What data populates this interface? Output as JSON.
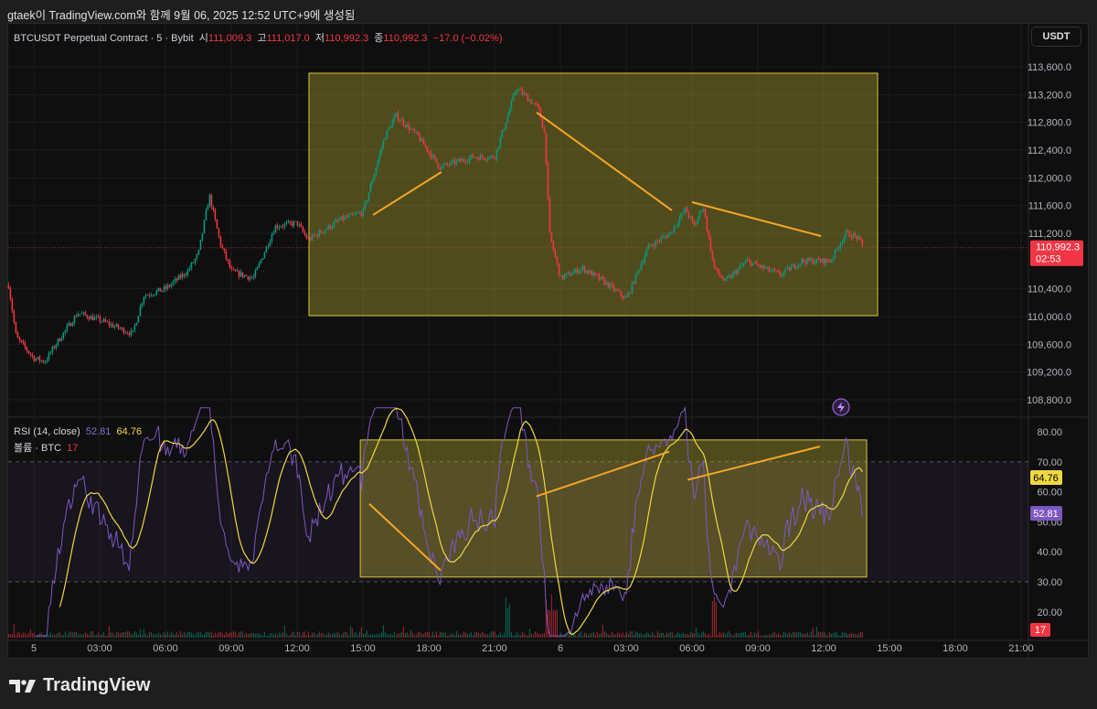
{
  "caption": "gtaek이 TradingView.com와 함께 9월 06, 2025 12:52 UTC+9에 생성됨",
  "legend": {
    "symbol": "BTCUSDT Perpetual Contract · 5 · Bybit",
    "open_label": "시",
    "open": "111,009.3",
    "high_label": "고",
    "high": "111,017.0",
    "low_label": "저",
    "low": "110,992.3",
    "close_label": "종",
    "close": "110,992.3",
    "change": "−17.0 (−0.02%)"
  },
  "rsi_legend": {
    "label": "RSI (14, close)",
    "rsi": "52.81",
    "ma": "64.76"
  },
  "volume_legend": {
    "label": "볼륨 · BTC",
    "value": "17"
  },
  "currency_button": "USDT",
  "price_tag": {
    "price": "110,992.3",
    "countdown": "02:53"
  },
  "rsi_tags": {
    "ma": "64.76",
    "rsi": "52.81",
    "volume": "17"
  },
  "brand": "TradingView",
  "colors": {
    "up": "#089981",
    "down": "#f23645",
    "rsi": "#7e57c2",
    "rsi_ma": "#f0d840",
    "drawing_box": "#d4c53a",
    "drawing_line": "#f5a623"
  },
  "chart_data": {
    "type": "candlestick",
    "interval_minutes": 5,
    "x_unit": "hours since 5 Sep 00:00",
    "price_axis": {
      "ticks": [
        "113,600.0",
        "113,200.0",
        "112,800.0",
        "112,400.0",
        "112,000.0",
        "111,600.0",
        "111,200.0",
        "110,400.0",
        "110,000.0",
        "109,600.0",
        "109,200.0",
        "108,800.0"
      ],
      "tick_values": [
        113600,
        113200,
        112800,
        112400,
        112000,
        111600,
        111200,
        110400,
        110000,
        109600,
        109200,
        108800
      ]
    },
    "rsi_axis": {
      "ticks": [
        "80.00",
        "70.00",
        "60.00",
        "50.00",
        "40.00",
        "30.00",
        "20.00"
      ],
      "tick_values": [
        80,
        70,
        60,
        50,
        40,
        30,
        20
      ],
      "bands": [
        30,
        70
      ]
    },
    "time_axis": {
      "labels": [
        "5",
        "03:00",
        "06:00",
        "09:00",
        "12:00",
        "15:00",
        "18:00",
        "21:00",
        "6",
        "03:00",
        "06:00",
        "09:00",
        "12:00",
        "15:00",
        "18:00",
        "21:00"
      ],
      "hours": [
        0,
        3,
        6,
        9,
        12,
        15,
        18,
        21,
        24,
        27,
        30,
        33,
        36,
        39,
        42,
        45
      ]
    },
    "price_path": [
      [
        -1.15,
        110450
      ],
      [
        -0.8,
        109700
      ],
      [
        0,
        109400
      ],
      [
        0.5,
        109350
      ],
      [
        1,
        109600
      ],
      [
        2,
        110050
      ],
      [
        3,
        109950
      ],
      [
        4.5,
        109750
      ],
      [
        5,
        110300
      ],
      [
        6,
        110400
      ],
      [
        7,
        110650
      ],
      [
        7.5,
        110900
      ],
      [
        8,
        111750
      ],
      [
        8.5,
        111050
      ],
      [
        9,
        110650
      ],
      [
        10,
        110550
      ],
      [
        11,
        111300
      ],
      [
        12,
        111350
      ],
      [
        12.5,
        111100
      ],
      [
        14,
        111400
      ],
      [
        15,
        111500
      ],
      [
        16,
        112600
      ],
      [
        16.5,
        112900
      ],
      [
        17.5,
        112600
      ],
      [
        18.5,
        112150
      ],
      [
        20,
        112300
      ],
      [
        21,
        112300
      ],
      [
        21.5,
        112800
      ],
      [
        22,
        113300
      ],
      [
        23,
        113000
      ],
      [
        23.3,
        112600
      ],
      [
        23.5,
        111200
      ],
      [
        24,
        110550
      ],
      [
        25,
        110700
      ],
      [
        26,
        110500
      ],
      [
        27,
        110250
      ],
      [
        28,
        111000
      ],
      [
        29,
        111200
      ],
      [
        29.7,
        111550
      ],
      [
        30.1,
        111300
      ],
      [
        30.5,
        111600
      ],
      [
        31,
        110700
      ],
      [
        31.5,
        110500
      ],
      [
        32.5,
        110800
      ],
      [
        34,
        110600
      ],
      [
        35,
        110800
      ],
      [
        36.3,
        110800
      ],
      [
        37,
        111200
      ],
      [
        37.5,
        111150
      ],
      [
        37.83,
        110992.3
      ]
    ],
    "last_price": 110992.3,
    "rsi_last": 52.81,
    "rsi_ma_last": 64.76,
    "volume_last": 17,
    "drawings": {
      "price_box": {
        "t": [
          12.54,
          38.46
        ],
        "price": [
          110013,
          113508
        ]
      },
      "price_lines": [
        {
          "t": [
            15.46,
            18.58
          ],
          "price": [
            111464,
            112083
          ]
        },
        {
          "t": [
            22.92,
            29.08
          ],
          "price": [
            112941,
            111530
          ]
        },
        {
          "t": [
            30.0,
            35.88
          ],
          "price": [
            111648,
            111160
          ]
        }
      ],
      "rsi_box": {
        "t": [
          14.88,
          37.96
        ],
        "rsi": [
          31.6,
          77.3
        ]
      },
      "rsi_lines": [
        {
          "t": [
            15.29,
            18.54
          ],
          "rsi": [
            56,
            33.8
          ]
        },
        {
          "t": [
            22.9,
            28.96
          ],
          "rsi": [
            58.5,
            73.4
          ]
        },
        {
          "t": [
            29.8,
            35.83
          ],
          "rsi": [
            64,
            75.1
          ]
        }
      ]
    }
  }
}
